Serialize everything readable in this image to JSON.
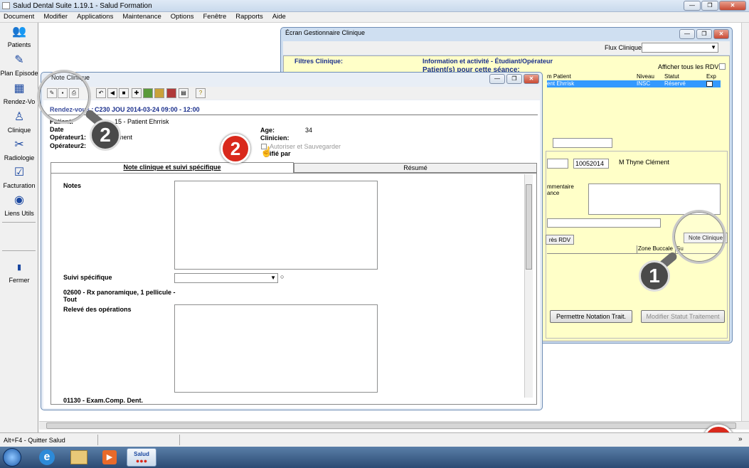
{
  "app": {
    "title": "Salud Dental Suite 1.19.1 - Salud Formation"
  },
  "menu": [
    "Document",
    "Modifier",
    "Applications",
    "Maintenance",
    "Options",
    "Fenêtre",
    "Rapports",
    "Aide"
  ],
  "sidebar": [
    {
      "label": "Patients",
      "icon": "patients-icon"
    },
    {
      "label": "Plan Episode",
      "icon": "plan-episode-icon"
    },
    {
      "label": "Rendez-Vo",
      "icon": "calendar-icon"
    },
    {
      "label": "Clinique",
      "icon": "tooth-icon"
    },
    {
      "label": "Radiologie",
      "icon": "xray-icon"
    },
    {
      "label": "Facturation",
      "icon": "billing-icon"
    },
    {
      "label": "Liens Utils",
      "icon": "globe-icon"
    },
    {
      "label": "Fermer",
      "icon": "exit-icon"
    }
  ],
  "clinic": {
    "title": "Écran Gestionnaire Clinique",
    "flux_label": "Flux Clinique:",
    "filters_label": "Filtres Clinique:",
    "info_label": "Information et activité - Étudiant/Opérateur",
    "patients_label": "Patient(s) pour cette séance:",
    "show_all": "Afficher tous les RDVs",
    "cols": [
      "m Patient",
      "Niveau",
      "Statut",
      "Exp"
    ],
    "row": {
      "patient": "ent Ehrrisk",
      "niveau": "INSC",
      "statut": "Réservé"
    },
    "id_field": "10052014",
    "clinician": "M Thyne Clément",
    "comment_label": "mmentaire",
    "comment_label2": "ance",
    "tab_label": "rès RDV",
    "note_btn": "Note Clinique",
    "grid_cols": [
      "Zone Buccale",
      "Su"
    ],
    "permit_btn": "Permettre Notation Trait.",
    "modify_btn": "Modifier Statut Traitement"
  },
  "note": {
    "title": "Note Clinique",
    "rdv_label": "Rendez-vous :",
    "rdv_value": "C230 JOU 2014-03-24 09:00 - 12:00",
    "patient_label": "Patient:",
    "patient_value": "15 - Patient Ehrrisk",
    "date_label": "Date",
    "operator1_label": "Opérateur1:",
    "operator1_value": "ément",
    "operator2_label": "Opérateur2:",
    "age_label": "Age:",
    "age_value": "34",
    "clinician_label": "Clinicien:",
    "authorize_label": "Autoriser et Sauvegarder",
    "verified_label": "ifié par",
    "tab1": "Note clinique et suivi spécifique",
    "tab2": "Résumé",
    "notes_label": "Notes",
    "suivi_label": "Suivi spécifique",
    "proc1": "02600 - Rx panoramique, 1 pellicule - Tout",
    "releve_label": "Relevé des opérations",
    "proc2": "01130 - Exam.Comp. Dent."
  },
  "callouts": {
    "one": "1",
    "two": "2"
  },
  "status": {
    "hint": "Alt+F4 - Quitter Salud"
  },
  "taskbar": {
    "app": "Salud"
  },
  "colors": {
    "badge_red": "#d9291c",
    "selection": "#3399ff",
    "yellow": "#ffffc8",
    "title_blue": "#1a2f8c"
  }
}
